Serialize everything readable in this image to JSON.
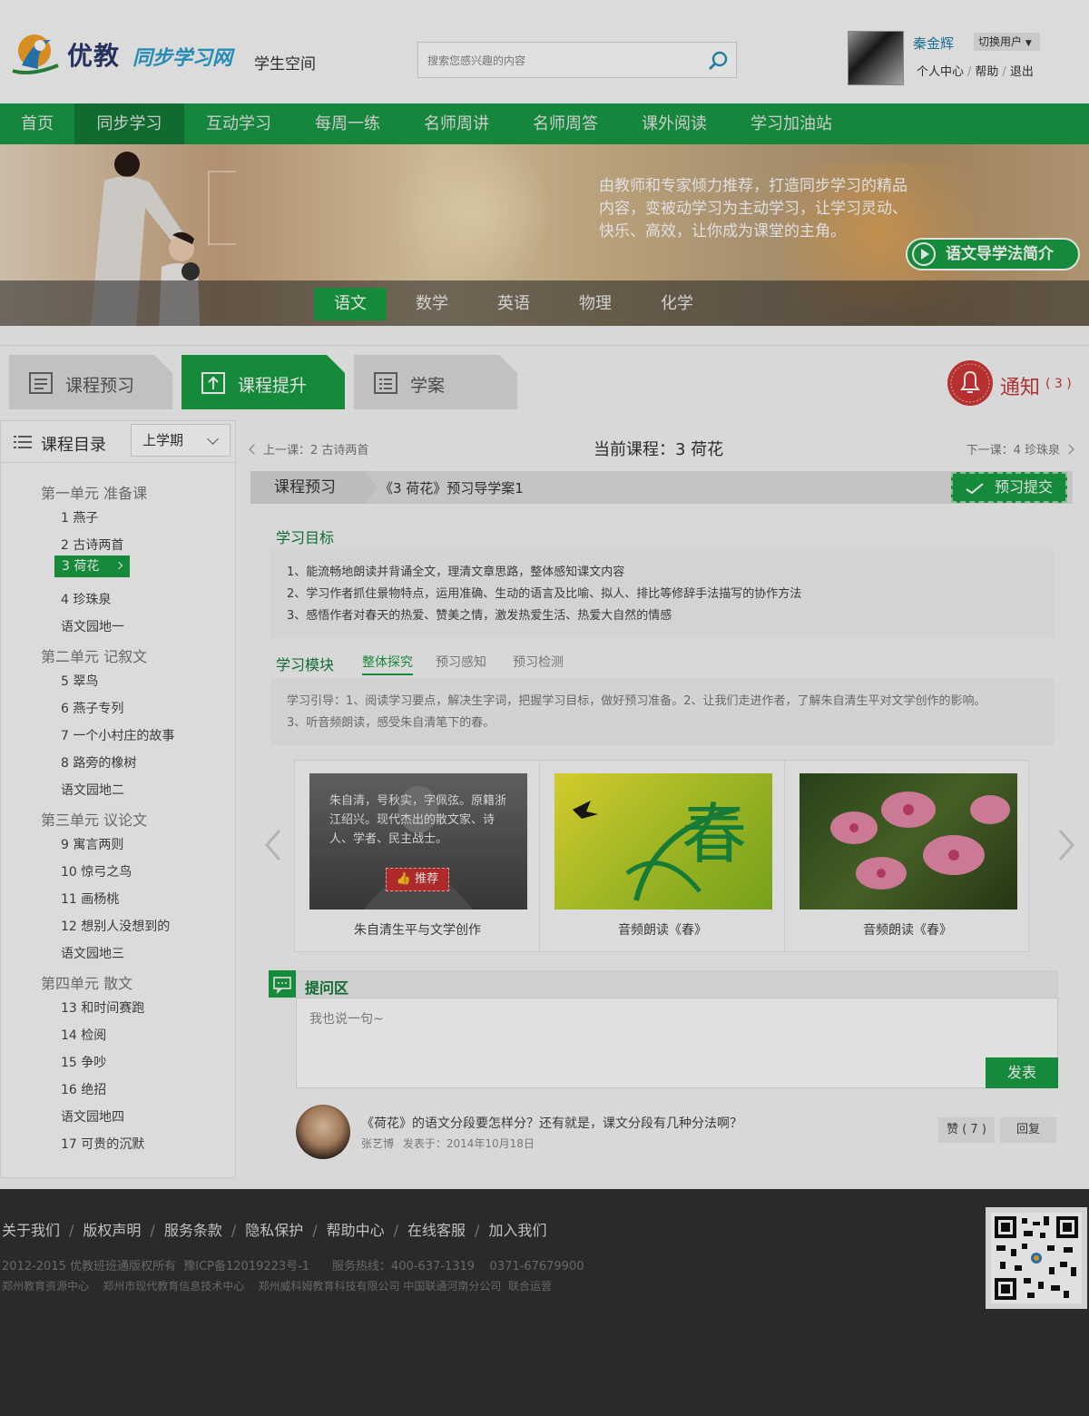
{
  "header": {
    "logo_text": "优教",
    "logo_sub": "同步学习网",
    "space_label": "学生空间",
    "search_placeholder": "搜索您感兴趣的内容",
    "username": "秦金辉",
    "switch_user": "切换用户",
    "links": [
      "个人中心",
      "帮助",
      "退出"
    ]
  },
  "nav": {
    "items": [
      "首页",
      "同步学习",
      "互动学习",
      "每周一练",
      "名师周讲",
      "名师周答",
      "课外阅读",
      "学习加油站"
    ],
    "active": "同步学习"
  },
  "banner": {
    "text": "由教师和专家倾力推荐，打造同步学习的精品内容，变被动学习为主动学习，让学习灵动、快乐、高效，让你成为课堂的主角。",
    "intro_button": "语文导学法简介",
    "subjects": [
      "语文",
      "数学",
      "英语",
      "物理",
      "化学"
    ],
    "active_subject": "语文"
  },
  "course_tabs": [
    "课程预习",
    "课程提升",
    "学案"
  ],
  "active_course_tab": "课程提升",
  "notice": {
    "label": "通知",
    "count": "( 3 )"
  },
  "sidebar": {
    "title": "课程目录",
    "term": "上学期",
    "units": [
      {
        "name": "第一单元 准备课",
        "lessons": [
          "1 燕子",
          "2 古诗两首",
          "3 荷花",
          "4 珍珠泉",
          "语文园地一"
        ]
      },
      {
        "name": "第二单元 记叙文",
        "lessons": [
          "5 翠鸟",
          "6 燕子专列",
          "7 一个小村庄的故事",
          "8 路旁的橡树",
          "语文园地二"
        ]
      },
      {
        "name": "第三单元 议论文",
        "lessons": [
          "9 寓言两则",
          "10 惊弓之鸟",
          "11 画杨桃",
          "12 想别人没想到的",
          "语文园地三"
        ]
      },
      {
        "name": "第四单元 散文",
        "lessons": [
          "13 和时间赛跑",
          "14 检阅",
          "15 争吵",
          "16 绝招",
          "语文园地四",
          "17 可贵的沉默"
        ]
      }
    ],
    "active_lesson": "3 荷花"
  },
  "main": {
    "prev": "上一课：2 古诗两首",
    "current": "当前课程：3 荷花",
    "next": "下一课：4 珍珠泉",
    "doc_tag": "课程预习",
    "doc_name": "《3 荷花》预习导学案1",
    "submit": "预习提交",
    "goals_title": "学习目标",
    "goals": [
      "1、能流畅地朗读并背诵全文，理清文章思路，整体感知课文内容",
      "2、学习作者抓住景物特点，运用准确、生动的语言及比喻、拟人、排比等修辞手法描写的协作方法",
      "3、感悟作者对春天的热爱、赞美之情，激发热爱生活、热爱大自然的情感"
    ],
    "module_title": "学习模块",
    "module_tabs": [
      "整体探究",
      "预习感知",
      "预习检测"
    ],
    "active_module": "整体探究",
    "guide_line1": "学习引导：1、阅读学习要点，解决生字词，把握学习目标，做好预习准备。2、让我们走进作者，了解朱自清生平对文学创作的影响。",
    "guide_line2": "3、听音频朗读，感受朱自清笔下的春。",
    "cards": [
      {
        "caption": "朱自清生平与文学创作",
        "overlay": "朱自清，号秋实，字佩弦。原籍浙江绍兴。现代杰出的散文家、诗人、学者、民主战士。",
        "badge": "推荐"
      },
      {
        "caption": "音频朗读《春》",
        "art_char": "春"
      },
      {
        "caption": "音频朗读《春》"
      }
    ],
    "qa_title": "提问区",
    "qa_placeholder": "我也说一句~",
    "post": "发表",
    "comment": {
      "text": "《荷花》的语文分段要怎样分？还有就是，课文分段有几种分法啊？",
      "author": "张艺博",
      "date": "发表于：2014年10月18日",
      "like": "赞 ( 7 )",
      "reply": "回复"
    }
  },
  "footer": {
    "links": [
      "关于我们",
      "版权声明",
      "服务条款",
      "隐私保护",
      "帮助中心",
      "在线客服",
      "加入我们"
    ],
    "copyright": "2012-2015 优教班班通版权所有  豫ICP备12019223号-1      服务热线：400-637-1319    0371-67679900",
    "orgs": "郑州教育资源中心    郑州市现代教育信息技术中心    郑州威科姆教育科技有限公司 中国联通河南分公司  联合运营"
  },
  "colors": {
    "brand_green": "#189a45",
    "dark_green": "#127a36",
    "notice_red": "#c73a3a",
    "footer_bg": "#303030"
  }
}
